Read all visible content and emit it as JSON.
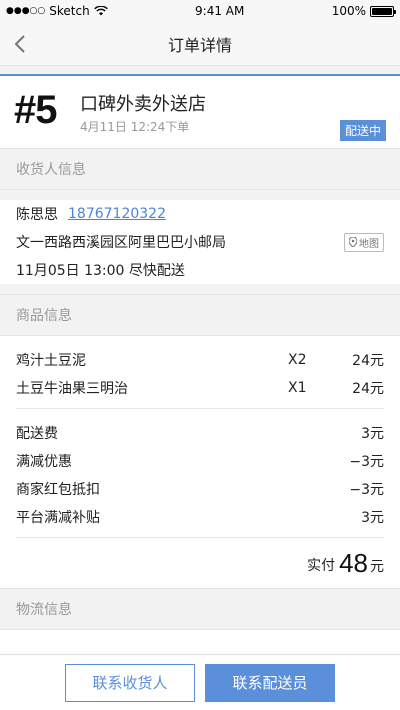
{
  "status_bar": {
    "carrier": "Sketch",
    "time": "9:41 AM",
    "battery": "100%"
  },
  "nav": {
    "title": "订单详情",
    "back_icon": "chevron-left-icon"
  },
  "order": {
    "number": "#5",
    "store_name": "口碑外卖外送店",
    "time": "4月11日 12:24下单",
    "status": "配送中"
  },
  "receiver_section": {
    "title": "收货人信息",
    "name": "陈思思",
    "phone": "18767120322",
    "address": "文一西路西溪园区阿里巴巴小邮局",
    "map_label": "地图",
    "delivery_time": "11月05日 13:00 尽快配送"
  },
  "goods_section": {
    "title": "商品信息",
    "items": [
      {
        "name": "鸡汁土豆泥",
        "qty": "X2",
        "price": "24元"
      },
      {
        "name": "土豆牛油果三明治",
        "qty": "X1",
        "price": "24元"
      }
    ],
    "fees": [
      {
        "label": "配送费",
        "value": "3元"
      },
      {
        "label": "满减优惠",
        "value": "−3元"
      },
      {
        "label": "商家红包抵扣",
        "value": "−3元"
      },
      {
        "label": "平台满减补贴",
        "value": "3元"
      }
    ],
    "total_label": "实付",
    "total_amount": "48",
    "total_unit": "元"
  },
  "logistics_section": {
    "title": "物流信息"
  },
  "actions": {
    "contact_receiver": "联系收货人",
    "contact_courier": "联系配送员"
  },
  "colors": {
    "accent": "#5b8fd9",
    "warning": "#f5a623"
  }
}
